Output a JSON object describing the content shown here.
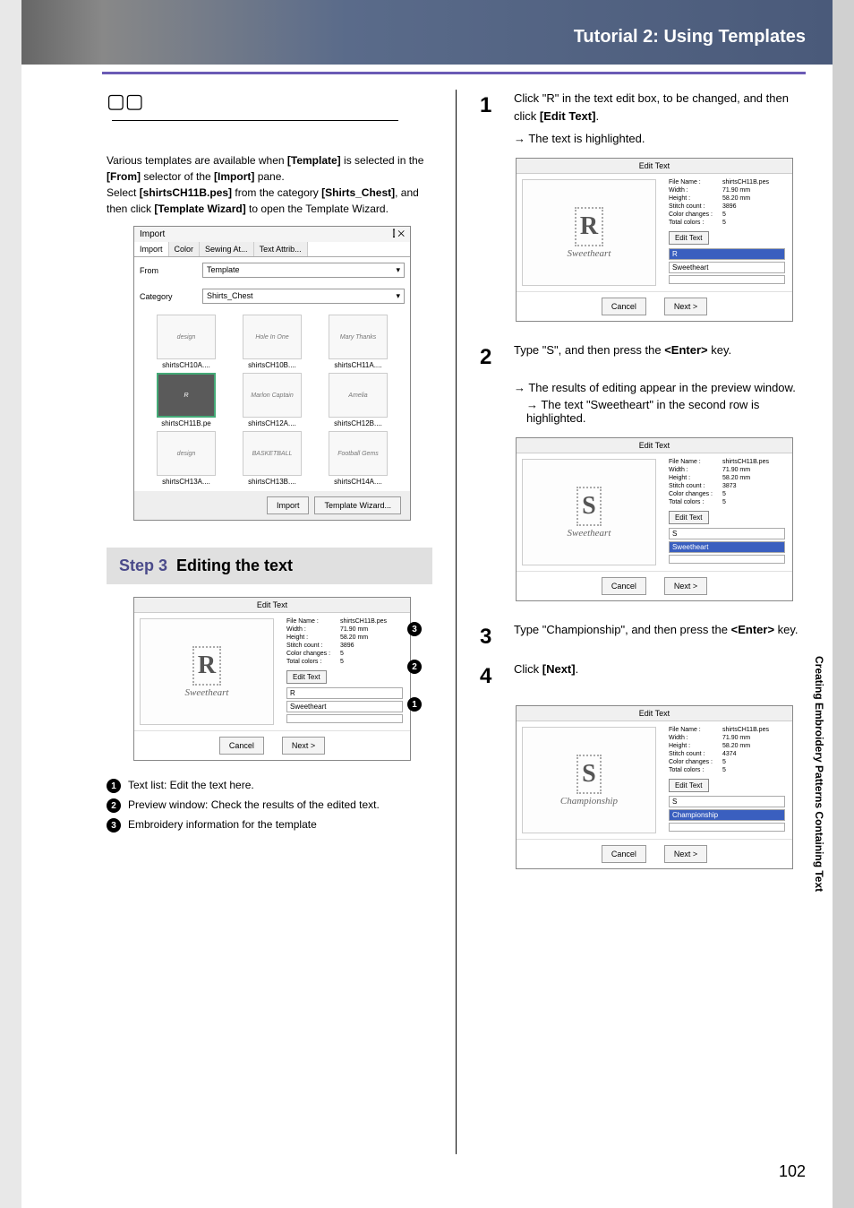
{
  "header": {
    "title": "Tutorial 2: Using Templates"
  },
  "side_tab": "Creating Embroidery Patterns Containing Text",
  "page_number": "102",
  "left": {
    "note": {
      "line1a": "Various templates are available when ",
      "line1b": "[Template]",
      "line2a": " is selected in the ",
      "line2b": "[From]",
      "line2c": " selector of the ",
      "line2d": "[Import]",
      "line2e": " pane.",
      "line3a": "Select ",
      "line3b": "[shirtsCH11B.pes]",
      "line3c": " from the category ",
      "line4a": "[Shirts_Chest]",
      "line4b": ", and then click ",
      "line4c": "[Template Wizard]",
      "line4d": " to open the Template Wizard."
    },
    "import_panel": {
      "title": "Import",
      "close_glyphs": "⫿  ✕",
      "tabs": [
        "Import",
        "Color",
        "Sewing At...",
        "Text Attrib..."
      ],
      "from_label": "From",
      "from_value": "Template",
      "category_label": "Category",
      "category_value": "Shirts_Chest",
      "thumbs": [
        {
          "img": "design",
          "cap": "shirtsCH10A...."
        },
        {
          "img": "Hole In One",
          "cap": "shirtsCH10B...."
        },
        {
          "img": "Mary Thanks",
          "cap": "shirtsCH11A...."
        },
        {
          "img": "R",
          "cap": "shirtsCH11B.pe",
          "selected": true
        },
        {
          "img": "Marlon Captain",
          "cap": "shirtsCH12A...."
        },
        {
          "img": "Amelia",
          "cap": "shirtsCH12B...."
        },
        {
          "img": "design",
          "cap": "shirtsCH13A...."
        },
        {
          "img": "BASKETBALL",
          "cap": "shirtsCH13B...."
        },
        {
          "img": "Football Gems",
          "cap": "shirtsCH14A...."
        }
      ],
      "import_btn": "Import",
      "wizard_btn": "Template Wizard..."
    },
    "step3": {
      "label": "Step 3",
      "title": "Editing the text"
    },
    "dialog1": {
      "title": "Edit Text",
      "info": {
        "file_name_k": "File Name :",
        "file_name_v": "shirtsCH11B.pes",
        "width_k": "Width :",
        "width_v": "71.90  mm",
        "height_k": "Height :",
        "height_v": "58.20  mm",
        "stitch_k": "Stitch count :",
        "stitch_v": "3896",
        "color_k": "Color changes :",
        "color_v": "5",
        "total_k": "Total colors :",
        "total_v": "5"
      },
      "edit_text_btn": "Edit Text",
      "row1": "R",
      "row2": "Sweetheart",
      "cancel": "Cancel",
      "next": "Next >",
      "preview_letter": "R",
      "preview_arc": "Sweetheart"
    },
    "legend": {
      "l1": "Text list: Edit the text here.",
      "l2": "Preview window: Check the results of the edited text.",
      "l3": "Embroidery information for the template"
    }
  },
  "right": {
    "step1": {
      "num": "1",
      "text_a": "Click \"R\" in the text edit box, to be changed, and then click ",
      "text_b": "[Edit Text]",
      "text_c": ".",
      "arrow": "The text is highlighted."
    },
    "dialogA": {
      "title": "Edit Text",
      "info": {
        "file_name_k": "File Name :",
        "file_name_v": "shirtsCH11B.pes",
        "width_k": "Width :",
        "width_v": "71.90  mm",
        "height_k": "Height :",
        "height_v": "58.20  mm",
        "stitch_k": "Stitch count :",
        "stitch_v": "3896",
        "color_k": "Color changes :",
        "color_v": "5",
        "total_k": "Total colors :",
        "total_v": "5"
      },
      "edit_text_btn": "Edit Text",
      "row1": "R",
      "row1_hl": true,
      "row2": "Sweetheart",
      "cancel": "Cancel",
      "next": "Next >",
      "preview_letter": "R",
      "preview_arc": "Sweetheart"
    },
    "step2": {
      "num": "2",
      "text_a": "Type \"S\", and then press the ",
      "text_b": "<Enter>",
      "text_c": " key.",
      "arrow1": "The results of editing appear in the preview window.",
      "arrow2": "The text \"Sweetheart\" in the second row is highlighted."
    },
    "dialogB": {
      "title": "Edit Text",
      "info": {
        "file_name_k": "File Name :",
        "file_name_v": "shirtsCH11B.pes",
        "width_k": "Width :",
        "width_v": "71.90  mm",
        "height_k": "Height :",
        "height_v": "58.20  mm",
        "stitch_k": "Stitch count :",
        "stitch_v": "3873",
        "color_k": "Color changes :",
        "color_v": "5",
        "total_k": "Total colors :",
        "total_v": "5"
      },
      "edit_text_btn": "Edit Text",
      "row1": "S",
      "row2": "Sweetheart",
      "row2_hl": true,
      "cancel": "Cancel",
      "next": "Next >",
      "preview_letter": "S",
      "preview_arc": "Sweetheart"
    },
    "step3": {
      "num": "3",
      "text_a": "Type \"Championship\", and then press the ",
      "text_b": "<Enter>",
      "text_c": " key."
    },
    "step4": {
      "num": "4",
      "text_a": "Click ",
      "text_b": "[Next]",
      "text_c": "."
    },
    "dialogC": {
      "title": "Edit Text",
      "info": {
        "file_name_k": "File Name :",
        "file_name_v": "shirtsCH11B.pes",
        "width_k": "Width :",
        "width_v": "71.90  mm",
        "height_k": "Height :",
        "height_v": "58.20  mm",
        "stitch_k": "Stitch count :",
        "stitch_v": "4374",
        "color_k": "Color changes :",
        "color_v": "5",
        "total_k": "Total colors :",
        "total_v": "5"
      },
      "edit_text_btn": "Edit Text",
      "row1": "S",
      "row2": "Championship",
      "row2_hl": true,
      "cancel": "Cancel",
      "next": "Next >",
      "preview_letter": "S",
      "preview_arc": "Championship"
    }
  }
}
